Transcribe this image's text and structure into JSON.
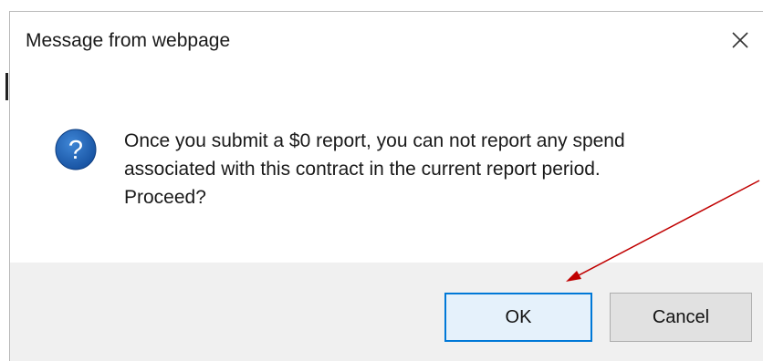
{
  "dialog": {
    "title": "Message from webpage",
    "close_icon": "close-icon",
    "question_icon": "question-icon",
    "message": "Once you submit a $0 report, you can not report any spend\nassociated with this contract in the current report period.\nProceed?",
    "buttons": {
      "ok_label": "OK",
      "cancel_label": "Cancel"
    }
  },
  "annotation": {
    "arrow_color": "#c00000",
    "arrow_target": "ok-button"
  },
  "colors": {
    "question_icon_blue": "#1c5eb0",
    "ok_focus_border": "#0078d7",
    "footer_bg": "#f0f0f0"
  }
}
